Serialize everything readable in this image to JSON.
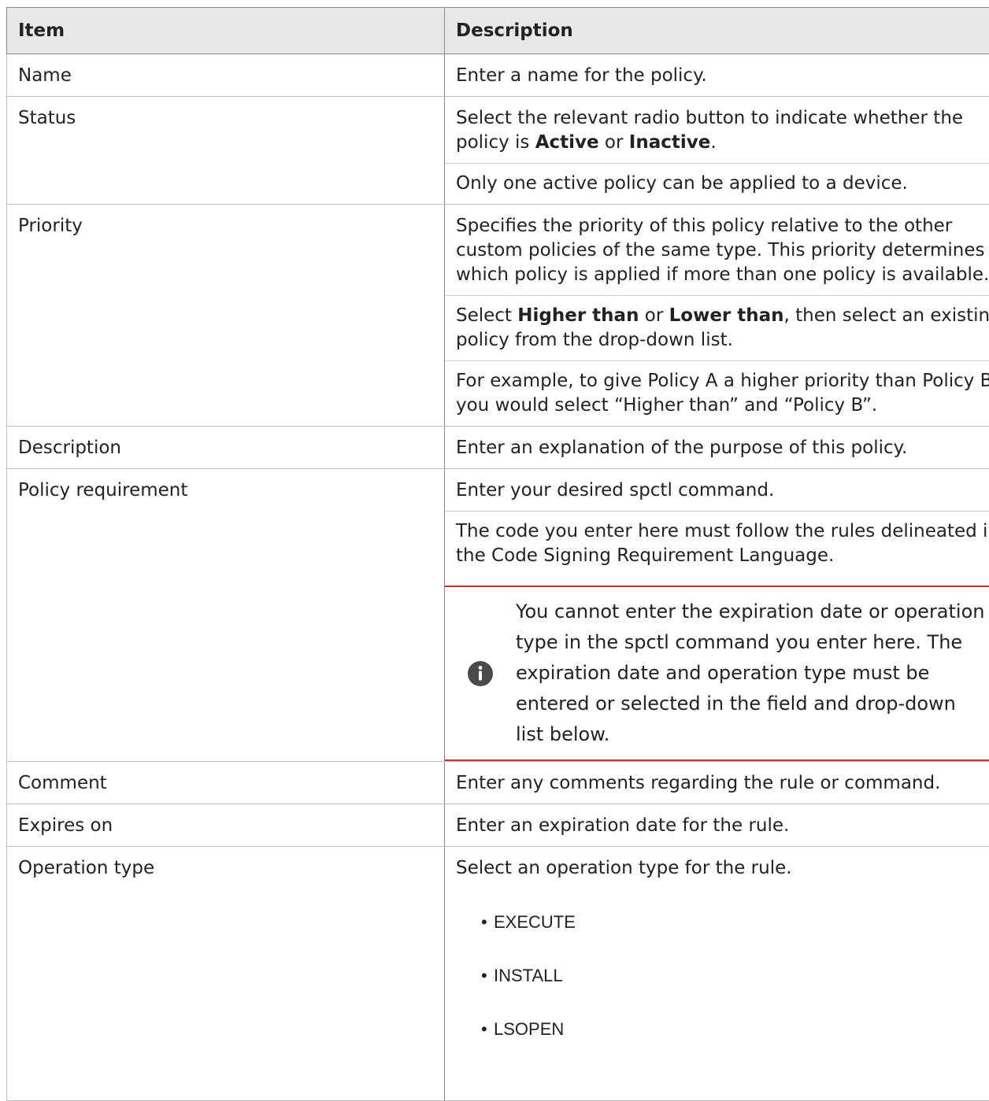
{
  "table": {
    "headers": [
      "Item",
      "Description"
    ],
    "name": {
      "item": "Name",
      "desc": "Enter a name for the policy."
    },
    "status": {
      "item": "Status",
      "desc_pre": "Select the relevant radio button to indicate whether the policy is ",
      "active": "Active",
      "or": " or ",
      "inactive": "Inactive",
      "period": ".",
      "desc2": "Only one active policy can be applied to a device."
    },
    "priority": {
      "item": "Priority",
      "desc1": "Specifies the priority of this policy relative to the other custom policies of the same type. This priority determines which policy is applied if more than one policy is available.",
      "select": "Select ",
      "higher": "Higher than",
      "or": " or ",
      "lower": "Lower than",
      "desc2_post": ", then select an existing policy from the drop-down list.",
      "desc3": "For example, to give Policy A a higher priority than Policy B, you would select “Higher than” and “Policy B”."
    },
    "description": {
      "item": "Description",
      "desc": "Enter an explanation of the purpose of this policy."
    },
    "policy_requirement": {
      "item": "Policy requirement",
      "desc1": "Enter your desired spctl command.",
      "desc2": "The code you enter here must follow the rules delineated in the Code Signing Requirement Language.",
      "note": "You cannot enter the expiration date or operation type in the spctl command you enter here. The expiration date and operation type must be entered or selected in the field and drop-down list below.",
      "note_icon": "info-icon"
    },
    "comment": {
      "item": "Comment",
      "desc": "Enter any comments regarding the rule or command."
    },
    "expires_on": {
      "item": "Expires on",
      "desc": "Enter an expiration date for the rule."
    },
    "operation_type": {
      "item": "Operation type",
      "desc": "Select an operation type for the rule.",
      "options": [
        "EXECUTE",
        "INSTALL",
        "LSOPEN"
      ]
    }
  },
  "colors": {
    "header_bg": "#e8e8e8",
    "note_rule": "#d32f2f",
    "icon_bg": "#4a4a4a"
  }
}
